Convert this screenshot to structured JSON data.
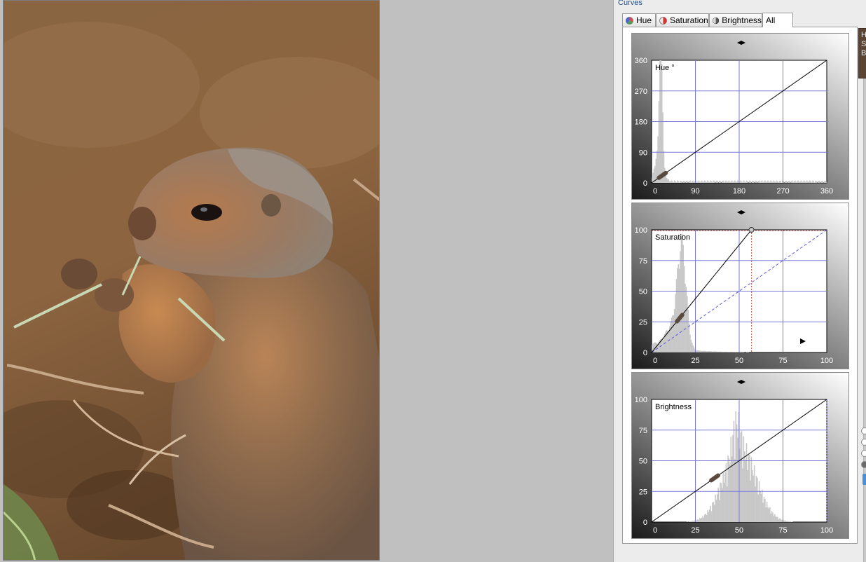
{
  "panel": {
    "title": "Curves",
    "tabs": [
      {
        "label": "Hue",
        "icon": "hue-wheel-icon",
        "active": false
      },
      {
        "label": "Saturation",
        "icon": "saturation-drop-icon",
        "active": false
      },
      {
        "label": "Brightness",
        "icon": "brightness-sphere-icon",
        "active": false
      },
      {
        "label": "All",
        "icon": "",
        "active": true
      }
    ],
    "side_labels": [
      "H",
      "S",
      "B"
    ]
  },
  "curves": [
    {
      "id": "hue",
      "label": "Hue °",
      "x_ticks": [
        "0",
        "90",
        "180",
        "270",
        "360"
      ],
      "y_ticks": [
        "0",
        "90",
        "180",
        "270",
        "360"
      ],
      "range": [
        0,
        360
      ],
      "curve_points": [
        [
          0,
          0
        ],
        [
          360,
          360
        ]
      ],
      "handle_at": [
        22,
        22
      ],
      "histogram_peak_at": 18
    },
    {
      "id": "saturation",
      "label": "Saturation",
      "x_ticks": [
        "0",
        "25",
        "50",
        "75",
        "100"
      ],
      "y_ticks": [
        "0",
        "25",
        "50",
        "75",
        "100"
      ],
      "range": [
        0,
        100
      ],
      "curve_points": [
        [
          0,
          0
        ],
        [
          57,
          100
        ]
      ],
      "endpoint_marker": [
        57,
        100
      ],
      "handle_at": [
        16,
        28
      ],
      "histogram_peak_at": 17
    },
    {
      "id": "brightness",
      "label": "Brightness",
      "x_ticks": [
        "0",
        "25",
        "50",
        "75",
        "100"
      ],
      "y_ticks": [
        "0",
        "25",
        "50",
        "75",
        "100"
      ],
      "range": [
        0,
        100
      ],
      "curve_points": [
        [
          0,
          0
        ],
        [
          100,
          100
        ]
      ],
      "handle_at": [
        36,
        36
      ],
      "histogram_peak_at": 50
    }
  ]
}
